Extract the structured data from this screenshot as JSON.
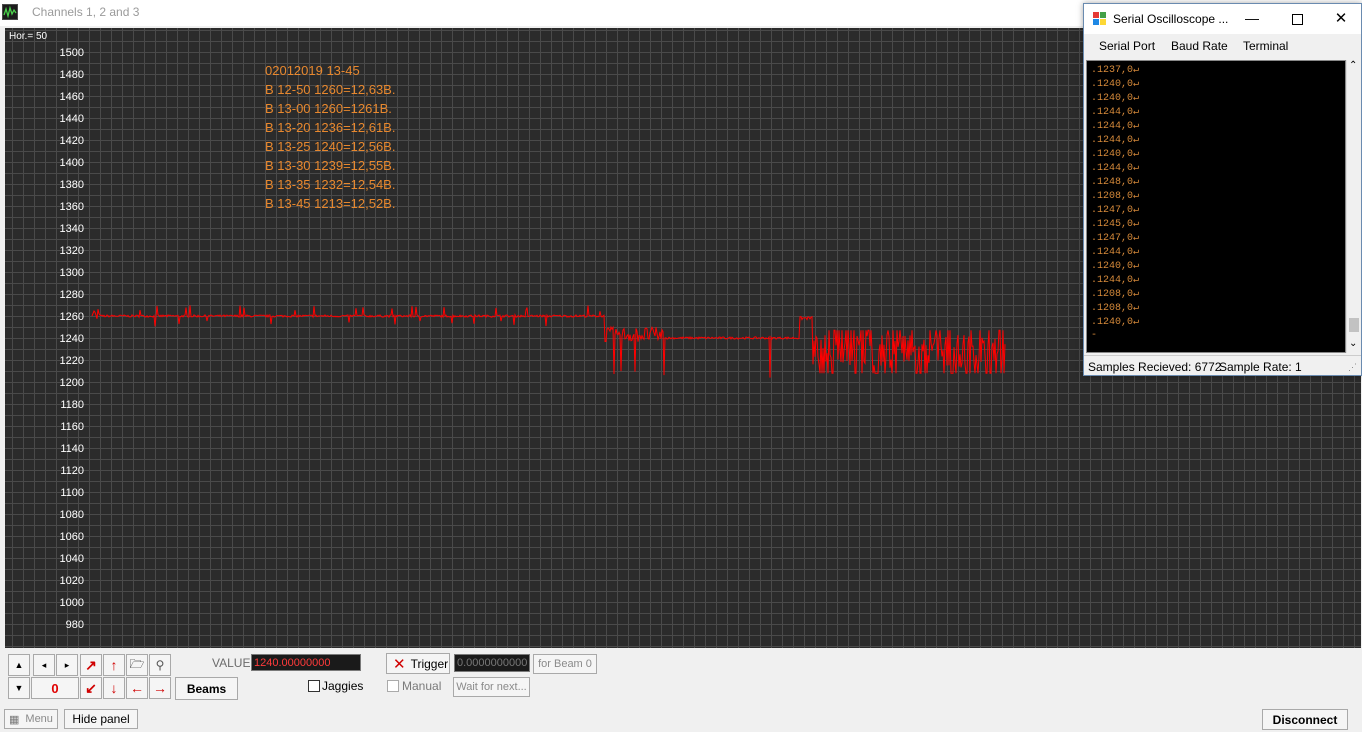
{
  "main_window": {
    "title": "Channels 1, 2 and 3"
  },
  "plot": {
    "hor_label": "Hor.=  50",
    "y_ticks": [
      "1500",
      "1480",
      "1460",
      "1440",
      "1420",
      "1400",
      "1380",
      "1360",
      "1340",
      "1320",
      "1300",
      "1280",
      "1260",
      "1240",
      "1220",
      "1200",
      "1180",
      "1160",
      "1140",
      "1120",
      "1100",
      "1080",
      "1060",
      "1040",
      "1020",
      "1000",
      "980"
    ],
    "annotations": [
      "02012019 13-45",
      "В 12-50 1260=12,63В.",
      "В 13-00 1260=1261В.",
      "В 13-20 1236=12,61В.",
      "В 13-25 1240=12,56В.",
      "В 13-30 1239=12,55В.",
      "В 13-35 1232=12,54В.",
      "В 13-45 1213=12,52В."
    ],
    "trace_color": "#ff0000",
    "grid_color": "#4a4a4a",
    "background_color": "#2b2b2b",
    "annotation_color": "#e8882e"
  },
  "controls": {
    "beam_index": "0",
    "beams_label": "Beams",
    "value_label": "VALUE:",
    "value": "1240.00000000",
    "trigger_label": "Trigger",
    "trigger_value": "0.0000000000",
    "for_beam_label": "for Beam 0",
    "jaggies_label": "Jaggies",
    "manual_label": "Manual",
    "wait_label": "Wait for next..."
  },
  "status_bar": {
    "menu_label": "Menu",
    "hide_panel_label": "Hide panel",
    "disconnect_label": "Disconnect"
  },
  "serial_window": {
    "title": "Serial Oscilloscope ...",
    "menu": [
      "Serial Port",
      "Baud Rate",
      "Terminal"
    ],
    "terminal_lines": [
      ".1237,0↵",
      ".1240,0↵",
      ".1240,0↵",
      ".1244,0↵",
      ".1244,0↵",
      ".1244,0↵",
      ".1240,0↵",
      ".1244,0↵",
      ".1248,0↵",
      ".1208,0↵",
      ".1247,0↵",
      ".1245,0↵",
      ".1247,0↵",
      ".1244,0↵",
      ".1240,0↵",
      ".1244,0↵",
      ".1208,0↵",
      ".1208,0↵",
      ".1240,0↵",
      "-"
    ],
    "samples_received": "Samples Recieved: 6772",
    "sample_rate": "Sample Rate: 1"
  }
}
